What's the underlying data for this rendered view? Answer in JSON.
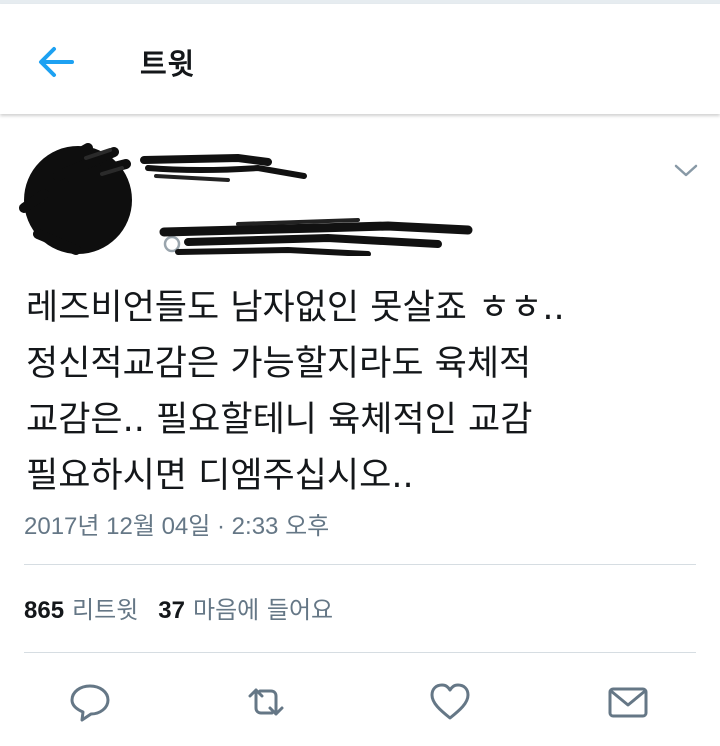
{
  "header": {
    "title": "트윗"
  },
  "tweet": {
    "lines": [
      "레즈비언들도 남자없인 못살죠 ㅎㅎ..",
      "정신적교감은 가능할지라도 육체적",
      "교감은.. 필요할테니 육체적인 교감",
      "필요하시면 디엠주십시오.."
    ],
    "timestamp": "2017년 12월 04일 · 2:33 오후"
  },
  "stats": {
    "retweets_count": "865",
    "retweets_label": "리트윗",
    "likes_count": "37",
    "likes_label": "마음에 들어요"
  },
  "colors": {
    "accent": "#1da1f2",
    "icon_gray": "#657786",
    "text": "#14171a"
  },
  "icons": {
    "back": "back-arrow-icon",
    "caret": "chevron-down-icon",
    "reply": "reply-icon",
    "retweet": "retweet-icon",
    "like": "heart-icon",
    "dm": "envelope-icon"
  }
}
